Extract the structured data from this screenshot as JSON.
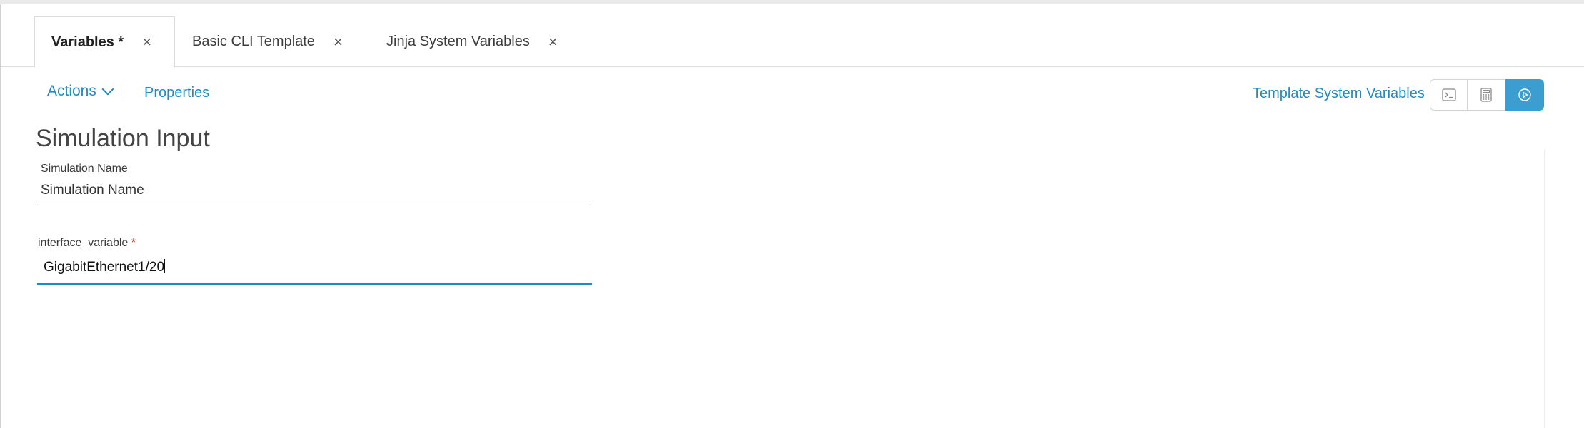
{
  "tabs": [
    {
      "label": "Variables *",
      "active": true
    },
    {
      "label": "Basic CLI Template",
      "active": false
    },
    {
      "label": "Jinja System Variables",
      "active": false
    }
  ],
  "tab_close_glyph": "×",
  "toolbar": {
    "actions_label": "Actions",
    "properties_label": "Properties",
    "template_system_variables_label": "Template System Variables",
    "buttons": [
      "terminal-icon",
      "calculator-icon",
      "play-circle-icon"
    ]
  },
  "section": {
    "title": "Simulation Input"
  },
  "fields": {
    "simulation_name": {
      "label": "Simulation Name",
      "value": "Simulation Name"
    },
    "interface_variable": {
      "label": "interface_variable",
      "required_marker": "*",
      "value": "GigabitEthernet1/20"
    }
  },
  "colors": {
    "link": "#1f8bc4",
    "primary_button": "#3c9dd0",
    "required": "#d0271d"
  }
}
